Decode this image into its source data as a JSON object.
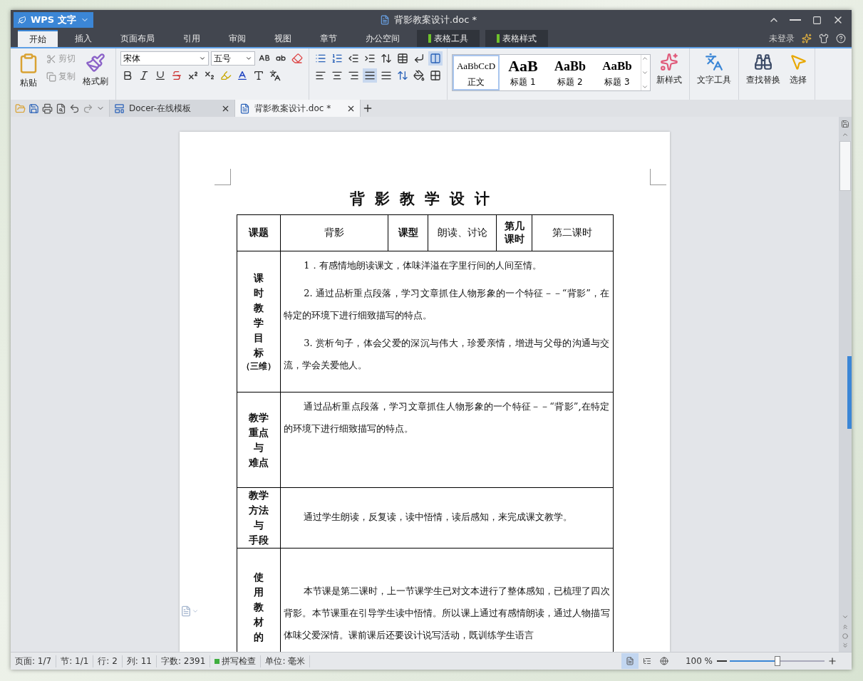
{
  "app_button": {
    "label": "WPS 文字"
  },
  "window": {
    "title": "背影教案设计.doc *"
  },
  "menu_tabs": [
    {
      "label": "开始",
      "selected": true,
      "kind": "main"
    },
    {
      "label": "插入",
      "selected": false,
      "kind": "main"
    },
    {
      "label": "页面布局",
      "selected": false,
      "kind": "main"
    },
    {
      "label": "引用",
      "selected": false,
      "kind": "main"
    },
    {
      "label": "审阅",
      "selected": false,
      "kind": "main"
    },
    {
      "label": "视图",
      "selected": false,
      "kind": "main"
    },
    {
      "label": "章节",
      "selected": false,
      "kind": "main"
    },
    {
      "label": "办公空间",
      "selected": false,
      "kind": "main"
    },
    {
      "label": "表格工具",
      "selected": false,
      "kind": "context"
    },
    {
      "label": "表格样式",
      "selected": false,
      "kind": "context"
    }
  ],
  "account": {
    "label": "未登录"
  },
  "ribbon": {
    "paste": "粘贴",
    "cut": {
      "label": "剪切",
      "disabled": true
    },
    "copy": {
      "label": "复制",
      "disabled": true
    },
    "format_painter": "格式刷",
    "font_name": "宋体",
    "font_size": "五号",
    "styles": [
      {
        "preview": "AaBbCcD",
        "label": "正文",
        "selected": true,
        "kind": "normal"
      },
      {
        "preview": "AaB",
        "label": "标题 1",
        "selected": false,
        "kind": "heading1"
      },
      {
        "preview": "AaBb",
        "label": "标题 2",
        "selected": false,
        "kind": "heading2"
      },
      {
        "preview": "AaBb",
        "label": "标题 3",
        "selected": false,
        "kind": "heading3"
      }
    ],
    "new_style": "新样式",
    "text_tools": "文字工具",
    "find_replace": "查找替换",
    "select": "选择"
  },
  "doc_tabs": [
    {
      "label": "Docer-在线模板",
      "selected": false,
      "kind": "docer"
    },
    {
      "label": "背影教案设计.doc *",
      "selected": true,
      "kind": "doc"
    }
  ],
  "document": {
    "title": "背影教学设计",
    "header_row": [
      {
        "text": "课题",
        "kind": "label"
      },
      {
        "text": "背影",
        "kind": "value"
      },
      {
        "text": "课型",
        "kind": "label"
      },
      {
        "text": "朗读、讨论",
        "kind": "value"
      },
      {
        "text": "第几课时",
        "kind": "label"
      },
      {
        "text": "第二课时",
        "kind": "value"
      }
    ],
    "rows": [
      {
        "label_lines": [
          "课",
          "时",
          "教",
          "学",
          "目",
          "标"
        ],
        "label_note": "（三维）",
        "kind": "top",
        "paragraphs": [
          "1．有感情地朗读课文，体味洋溢在字里行间的人间至情。",
          "2. 通过品析重点段落，学习文章抓住人物形象的一个特征－－“背影”，在特定的环境下进行细致描写的特点。",
          "3. 赏析句子，体会父爱的深沉与伟大，珍爱亲情，增进与父母的沟通与交流，学会关爱他人。"
        ]
      },
      {
        "label_lines": [
          "教学",
          "重点",
          "与",
          "难点"
        ],
        "kind": "top",
        "paragraphs": [
          "通过品析重点段落，学习文章抓住人物形象的一个特征－－“背影”,在特定的环境下进行细致描写的特点。"
        ]
      },
      {
        "label_lines": [
          "教学",
          "方法",
          "与",
          "手段"
        ],
        "kind": "middle",
        "paragraphs": [
          "通过学生朗读，反复读，读中悟情，读后感知，来完成课文教学。"
        ]
      },
      {
        "label_lines": [
          "使",
          "用",
          "教",
          "材",
          "的"
        ],
        "kind": "lower",
        "paragraphs": [
          "本节课是第二课时，上一节课学生已对文本进行了整体感知，已梳理了四次背影。本节课重在引导学生读中悟情。所以课上通过有感情朗读，通过人物描写体味父爱深情。课前课后还要设计说写活动，既训练学生语言"
        ]
      }
    ]
  },
  "status_bar": {
    "items": [
      "页面: 1/7",
      "节: 1/1",
      "行: 2",
      "列: 11",
      "字数: 2391"
    ],
    "spell_check": {
      "label": "拼写检查",
      "on": true
    },
    "unit": "单位: 毫米",
    "views": [
      {
        "selected": true,
        "kind": "page"
      },
      {
        "selected": false,
        "kind": "outline"
      },
      {
        "selected": false,
        "kind": "web"
      }
    ],
    "zoom": {
      "label": "100 %",
      "level": 0.5
    }
  }
}
